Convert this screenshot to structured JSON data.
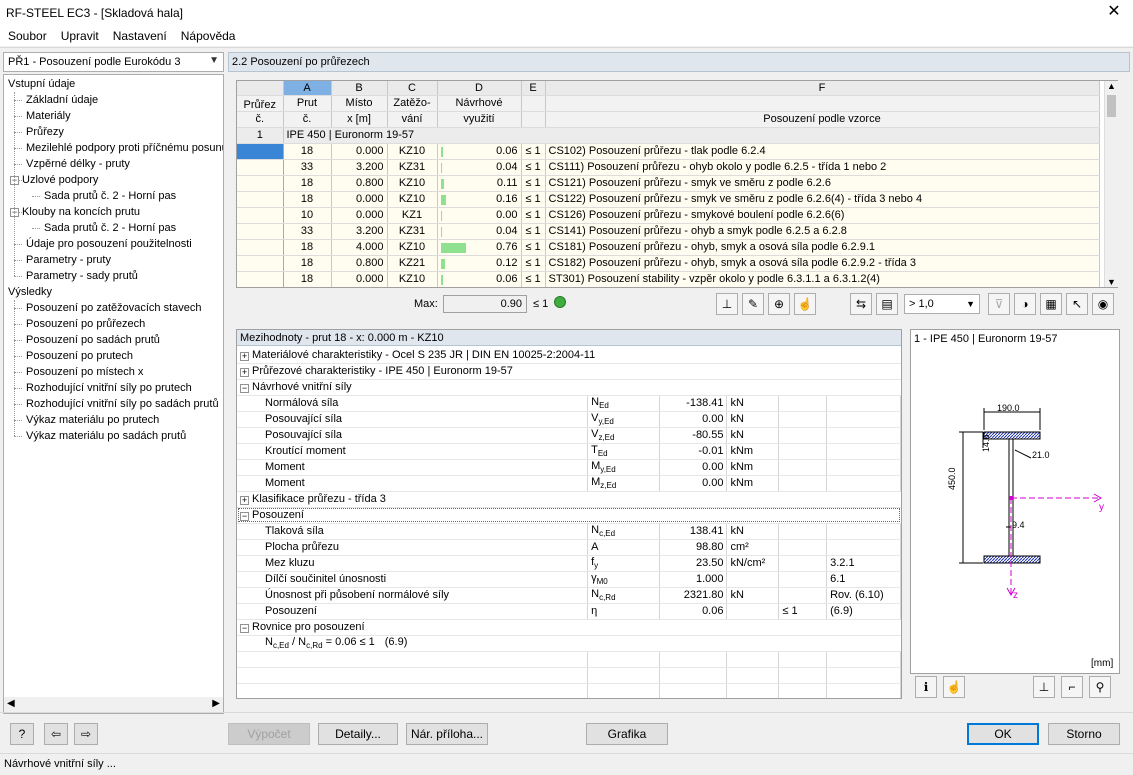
{
  "window": {
    "title": "RF-STEEL EC3 - [Skladová hala]"
  },
  "menu": [
    "Soubor",
    "Upravit",
    "Nastavení",
    "Nápověda"
  ],
  "module": {
    "selected": "PŘ1 - Posouzení podle Eurokódu 3"
  },
  "nav": [
    {
      "label": "Vstupní údaje",
      "level": 0
    },
    {
      "label": "Základní údaje",
      "level": 1
    },
    {
      "label": "Materiály",
      "level": 1
    },
    {
      "label": "Průřezy",
      "level": 1
    },
    {
      "label": "Mezilehlé podpory proti příčnému posunu",
      "level": 1
    },
    {
      "label": "Vzpěrné délky - pruty",
      "level": 1
    },
    {
      "label": "Uzlové podpory",
      "level": 1,
      "toggle": "-"
    },
    {
      "label": "Sada prutů č. 2 - Horní pas",
      "level": 2
    },
    {
      "label": "Klouby na koncích prutu",
      "level": 1,
      "toggle": "-"
    },
    {
      "label": "Sada prutů č. 2 - Horní pas",
      "level": 2
    },
    {
      "label": "Údaje pro posouzení použitelnosti",
      "level": 1
    },
    {
      "label": "Parametry - pruty",
      "level": 1
    },
    {
      "label": "Parametry - sady prutů",
      "level": 1
    },
    {
      "label": "Výsledky",
      "level": 0
    },
    {
      "label": "Posouzení po zatěžovacích stavech",
      "level": 1
    },
    {
      "label": "Posouzení po průřezech",
      "level": 1,
      "selected": true
    },
    {
      "label": "Posouzení po sadách prutů",
      "level": 1
    },
    {
      "label": "Posouzení po prutech",
      "level": 1
    },
    {
      "label": "Posouzení po místech x",
      "level": 1
    },
    {
      "label": "Rozhodující vnitřní síly po prutech",
      "level": 1
    },
    {
      "label": "Rozhodující vnitřní síly po sadách prutů",
      "level": 1
    },
    {
      "label": "Výkaz materiálu po prutech",
      "level": 1
    },
    {
      "label": "Výkaz materiálu po sadách prutů",
      "level": 1
    }
  ],
  "section": {
    "title": "2.2 Posouzení po průřezech"
  },
  "grid": {
    "letters": [
      "A",
      "B",
      "C",
      "D",
      "E",
      "F"
    ],
    "head1": [
      "Průřez",
      "Prut",
      "Místo",
      "Zatěžo-",
      "Návrhové",
      "",
      ""
    ],
    "head2": [
      "č.",
      "č.",
      "x [m]",
      "vání",
      "využití",
      "",
      "Posouzení podle vzorce"
    ],
    "group": {
      "no": "1",
      "label": "IPE 450 | Euronorm 19-57"
    },
    "rows": [
      {
        "member": "18",
        "x": "0.000",
        "lc": "KZ10",
        "util": "0.06",
        "le": "≤ 1",
        "formula": "CS102) Posouzení průřezu - tlak podle 6.2.4"
      },
      {
        "member": "33",
        "x": "3.200",
        "lc": "KZ31",
        "util": "0.04",
        "le": "≤ 1",
        "formula": "CS111) Posouzení průřezu - ohyb okolo y podle 6.2.5 - třída 1 nebo 2"
      },
      {
        "member": "18",
        "x": "0.800",
        "lc": "KZ10",
        "util": "0.11",
        "le": "≤ 1",
        "formula": "CS121) Posouzení průřezu - smyk ve směru z podle 6.2.6"
      },
      {
        "member": "18",
        "x": "0.000",
        "lc": "KZ10",
        "util": "0.16",
        "le": "≤ 1",
        "formula": "CS122) Posouzení průřezu - smyk ve směru z podle 6.2.6(4) - třída 3 nebo 4"
      },
      {
        "member": "10",
        "x": "0.000",
        "lc": "KZ1",
        "util": "0.00",
        "le": "≤ 1",
        "formula": "CS126) Posouzení průřezu - smykové boulení podle 6.2.6(6)"
      },
      {
        "member": "33",
        "x": "3.200",
        "lc": "KZ31",
        "util": "0.04",
        "le": "≤ 1",
        "formula": "CS141) Posouzení průřezu - ohyb a smyk podle 6.2.5 a 6.2.8"
      },
      {
        "member": "18",
        "x": "4.000",
        "lc": "KZ10",
        "util": "0.76",
        "le": "≤ 1",
        "formula": "CS181) Posouzení průřezu - ohyb, smyk a osová síla podle 6.2.9.1"
      },
      {
        "member": "18",
        "x": "0.800",
        "lc": "KZ21",
        "util": "0.12",
        "le": "≤ 1",
        "formula": "CS182) Posouzení průřezu - ohyb, smyk a osová síla podle 6.2.9.2 - třída 3"
      },
      {
        "member": "18",
        "x": "0.000",
        "lc": "KZ10",
        "util": "0.06",
        "le": "≤ 1",
        "formula": "ST301) Posouzení stability - vzpěr okolo y podle 6.3.1.1 a 6.3.1.2(4)"
      }
    ]
  },
  "max": {
    "label": "Max:",
    "value": "0.90",
    "le": "≤ 1"
  },
  "filter": {
    "value": "> 1,0"
  },
  "intermediate": {
    "title": "Mezihodnoty - prut 18 - x: 0.000 m - KZ10",
    "groups": {
      "mat": "Materiálové charakteristiky - Ocel S 235 JR | DIN EN 10025-2:2004-11",
      "sec": "Průřezové charakteristiky -  IPE 450 | Euronorm 19-57",
      "forces": "Návrhové vnitřní síly",
      "cls": "Klasifikace průřezu - třída 3",
      "check": "Posouzení",
      "eq": "Rovnice pro posouzení"
    },
    "forces": [
      {
        "name": "Normálová síla",
        "sym": "N",
        "sub": "Ed",
        "val": "-138.41",
        "unit": "kN"
      },
      {
        "name": "Posouvající síla",
        "sym": "V",
        "sub": "y,Ed",
        "val": "0.00",
        "unit": "kN"
      },
      {
        "name": "Posouvající síla",
        "sym": "V",
        "sub": "z,Ed",
        "val": "-80.55",
        "unit": "kN"
      },
      {
        "name": "Kroutící moment",
        "sym": "T",
        "sub": "Ed",
        "val": "-0.01",
        "unit": "kNm"
      },
      {
        "name": "Moment",
        "sym": "M",
        "sub": "y,Ed",
        "val": "0.00",
        "unit": "kNm"
      },
      {
        "name": "Moment",
        "sym": "M",
        "sub": "z,Ed",
        "val": "0.00",
        "unit": "kNm"
      }
    ],
    "checks": [
      {
        "name": "Tlaková síla",
        "sym": "N",
        "sub": "c,Ed",
        "val": "138.41",
        "unit": "kN",
        "le": "",
        "ref": ""
      },
      {
        "name": "Plocha průřezu",
        "sym": "A",
        "sub": "",
        "val": "98.80",
        "unit": "cm²",
        "le": "",
        "ref": ""
      },
      {
        "name": "Mez kluzu",
        "sym": "f",
        "sub": "y",
        "val": "23.50",
        "unit": "kN/cm²",
        "le": "",
        "ref": "3.2.1"
      },
      {
        "name": "Dílčí součinitel únosnosti",
        "sym": "γ",
        "sub": "M0",
        "val": "1.000",
        "unit": "",
        "le": "",
        "ref": "6.1"
      },
      {
        "name": "Únosnost při působení normálové síly",
        "sym": "N",
        "sub": "c,Rd",
        "val": "2321.80",
        "unit": "kN",
        "le": "",
        "ref": "Rov. (6.10)"
      },
      {
        "name": "Posouzení",
        "sym": "η",
        "sub": "",
        "val": "0.06",
        "unit": "",
        "le": "≤ 1",
        "ref": "(6.9)"
      }
    ],
    "equation": {
      "lhs": "N",
      "lsub": "c,Ed",
      "mid": " / N",
      "msub": "c,Rd",
      "rhs": " = 0.06 ≤ 1",
      "ref": "(6.9)"
    }
  },
  "section_panel": {
    "title": "1 - IPE 450 | Euronorm 19-57",
    "dims": {
      "width": "190.0",
      "height": "450.0",
      "tf": "14.6",
      "r": "21.0",
      "tw": "9.4"
    },
    "axis_y": "y",
    "axis_z": "z",
    "unit": "[mm]"
  },
  "buttons": {
    "calc": "Výpočet",
    "details": "Detaily...",
    "annex": "Nár. příloha...",
    "graphics": "Grafika",
    "ok": "OK",
    "cancel": "Storno"
  },
  "status": "Návrhové vnitřní síly ...",
  "colors": {
    "util_bar": "#8fe08f",
    "selected": "#3a85d6",
    "header": "#dfe6ee"
  }
}
